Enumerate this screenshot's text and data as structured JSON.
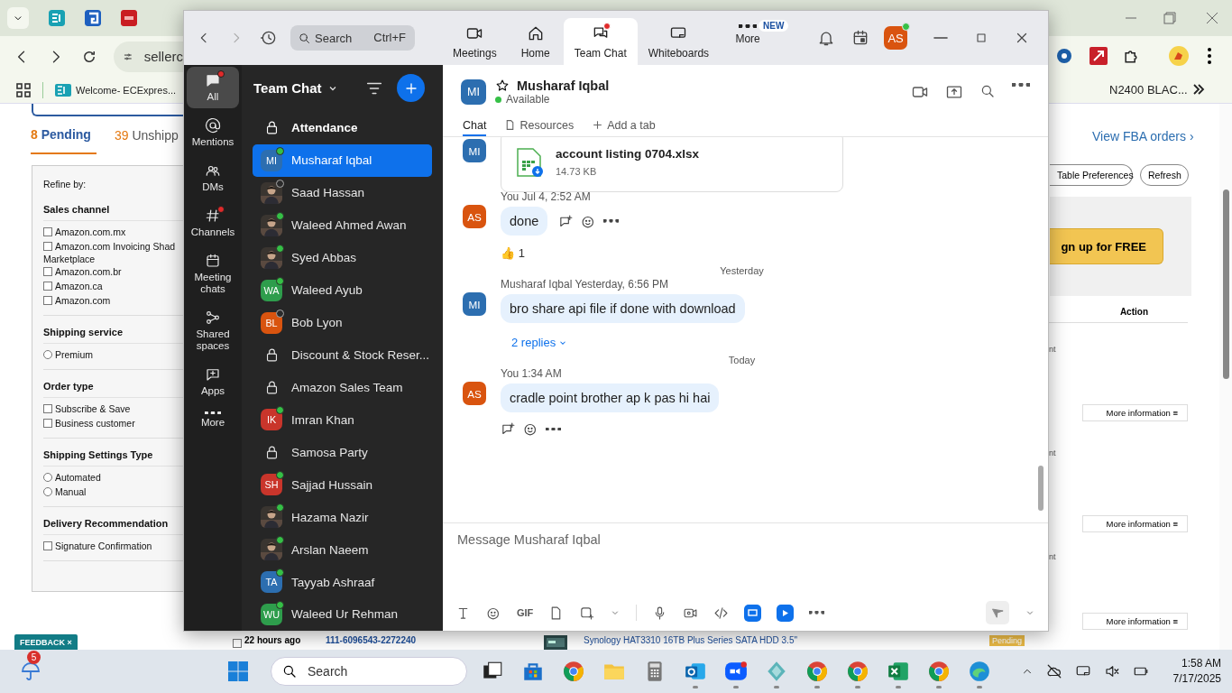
{
  "browser": {
    "address": "sellerc",
    "bookmarks": [
      "Welcome- ECExpres...",
      "N2400 BLAC..."
    ],
    "order_tabs": [
      {
        "count": "8",
        "label": "Pending",
        "selected": true
      },
      {
        "count": "39",
        "label": "Unshipp",
        "selected": false
      }
    ],
    "view_fba": "View FBA orders ›",
    "refine_label": "Refine by:",
    "filters": [
      {
        "title": "Sales channel",
        "options": [
          {
            "kind": "checkbox",
            "label": "Amazon.com.mx",
            "checked": false
          },
          {
            "kind": "checkbox",
            "label": "Amazon.com Invoicing Shad",
            "checked": false,
            "continuation": "Marketplace"
          },
          {
            "kind": "checkbox",
            "label": "Amazon.com.br",
            "checked": false
          },
          {
            "kind": "checkbox",
            "label": "Amazon.ca",
            "checked": false
          },
          {
            "kind": "checkbox",
            "label": "Amazon.com",
            "checked": false
          }
        ]
      },
      {
        "title": "Shipping service",
        "options": [
          {
            "kind": "radio",
            "label": "Premium",
            "checked": false
          }
        ]
      },
      {
        "title": "Order type",
        "options": [
          {
            "kind": "checkbox",
            "label": "Subscribe & Save",
            "checked": false
          },
          {
            "kind": "checkbox",
            "label": "Business customer",
            "checked": false
          }
        ]
      },
      {
        "title": "Shipping Settings Type",
        "options": [
          {
            "kind": "radio",
            "label": "Automated",
            "checked": false
          },
          {
            "kind": "radio",
            "label": "Manual",
            "checked": false
          }
        ]
      },
      {
        "title": "Delivery Recommendation",
        "options": [
          {
            "kind": "checkbox",
            "label": "Signature Confirmation",
            "checked": false
          }
        ]
      }
    ],
    "table_buttons": [
      "Table Preferences",
      "Refresh"
    ],
    "banner_button": "gn up for FREE",
    "action_header": "Action",
    "row_fragments": [
      "nt",
      "nt",
      "nt"
    ],
    "more_info": [
      "More information ≡",
      "More information ≡",
      "More information ≡"
    ],
    "order_row": {
      "checked": false,
      "age": "22 hours ago",
      "order_id": "111-6096543-2272240",
      "product": "Synology HAT3310 16TB Plus Series SATA HDD 3.5\"",
      "status": "Pending"
    },
    "feedback": "FEEDBACK ×"
  },
  "zoom": {
    "search": {
      "placeholder": "Search",
      "shortcut": "Ctrl+F"
    },
    "nav": [
      {
        "kind": "meetings",
        "label": "Meetings",
        "selected": false,
        "unread": false
      },
      {
        "kind": "home",
        "label": "Home",
        "selected": false,
        "unread": false
      },
      {
        "kind": "chat",
        "label": "Team Chat",
        "selected": true,
        "unread": true
      },
      {
        "kind": "whiteboards",
        "label": "Whiteboards",
        "selected": false,
        "unread": false
      },
      {
        "kind": "more",
        "label": "More",
        "selected": false,
        "unread": false,
        "badge": "NEW"
      }
    ],
    "user": {
      "initials": "AS",
      "color": "#d9540f",
      "online": true
    },
    "rail": [
      {
        "kind": "all",
        "label": "All",
        "selected": true,
        "unread": true
      },
      {
        "kind": "mentions",
        "label": "Mentions",
        "selected": false,
        "unread": false
      },
      {
        "kind": "dms",
        "label": "DMs",
        "selected": false,
        "unread": false
      },
      {
        "kind": "channels",
        "label": "Channels",
        "selected": false,
        "unread": true
      },
      {
        "kind": "meeting",
        "label": "Meeting chats",
        "selected": false,
        "unread": false
      },
      {
        "kind": "shared",
        "label": "Shared spaces",
        "selected": false,
        "unread": false
      },
      {
        "kind": "apps",
        "label": "Apps",
        "selected": false,
        "unread": false
      },
      {
        "kind": "more",
        "label": "More",
        "selected": false,
        "unread": false
      }
    ],
    "list_title": "Team Chat",
    "chats": [
      {
        "kind": "channel",
        "name": "Attendance",
        "selected": false,
        "bold": true
      },
      {
        "kind": "initials",
        "initials": "MI",
        "color": "#2c6eb0",
        "name": "Musharaf Iqbal",
        "selected": true,
        "online": true,
        "bold": false
      },
      {
        "name": "Saad Hassan",
        "selected": false,
        "online": false,
        "bold": false
      },
      {
        "name": "Waleed Ahmed Awan",
        "selected": false,
        "online": true,
        "bold": false
      },
      {
        "name": "Syed Abbas",
        "selected": false,
        "online": true,
        "bold": false
      },
      {
        "kind": "initials",
        "initials": "WA",
        "color": "#2e9d4c",
        "name": "Waleed Ayub",
        "selected": false,
        "online": true,
        "bold": false
      },
      {
        "kind": "initials",
        "initials": "BL",
        "color": "#d9540f",
        "name": "Bob Lyon",
        "selected": false,
        "online": false,
        "bold": false
      },
      {
        "kind": "channel",
        "name": "Discount & Stock Reser...",
        "selected": false,
        "bold": false
      },
      {
        "kind": "channel",
        "name": "Amazon Sales Team",
        "selected": false,
        "bold": false
      },
      {
        "kind": "initials",
        "initials": "IK",
        "color": "#c9352b",
        "name": "Imran Khan",
        "selected": false,
        "online": true,
        "bold": false
      },
      {
        "kind": "channel",
        "name": "Samosa Party",
        "selected": false,
        "bold": false
      },
      {
        "kind": "initials",
        "initials": "SH",
        "color": "#c9352b",
        "name": "Sajjad Hussain",
        "selected": false,
        "online": true,
        "bold": false
      },
      {
        "name": "Hazama Nazir",
        "selected": false,
        "online": true,
        "bold": false
      },
      {
        "name": "Arslan Naeem",
        "selected": false,
        "online": true,
        "bold": false
      },
      {
        "kind": "initials",
        "initials": "TA",
        "color": "#2c6eb0",
        "name": "Tayyab Ashraaf",
        "selected": false,
        "online": true,
        "bold": false
      },
      {
        "kind": "initials",
        "initials": "WU",
        "color": "#2e9d4c",
        "name": "Waleed Ur Rehman",
        "selected": false,
        "online": true,
        "bold": false
      }
    ],
    "contact": {
      "initials": "MI",
      "color": "#2c6eb0",
      "name": "Musharaf Iqbal",
      "status": "Available"
    },
    "chat_tabs": [
      {
        "kind": "chat",
        "label": "Chat",
        "selected": true
      },
      {
        "kind": "resources",
        "label": "Resources",
        "selected": false
      },
      {
        "kind": "add",
        "label": "Add a tab",
        "selected": false
      }
    ],
    "messages": [
      {
        "kind": "file",
        "initials": "MI",
        "color": "#2c6eb0",
        "file_name": "account listing 0704.xlsx",
        "file_size": "14.73 KB"
      },
      {
        "kind": "message",
        "initials": "AS",
        "color": "#d9540f",
        "author": "You",
        "time": "Jul 4, 2:52 AM",
        "text": "done",
        "actions_below": false,
        "reaction": {
          "emoji": "👍",
          "count": "1"
        }
      },
      {
        "kind": "divider",
        "label": "Yesterday"
      },
      {
        "kind": "message",
        "initials": "MI",
        "color": "#2c6eb0",
        "author": "Musharaf Iqbal",
        "time": "Yesterday, 6:56 PM",
        "text": "bro share api file if done with download",
        "replies": "2 replies"
      },
      {
        "kind": "divider",
        "label": "Today"
      },
      {
        "kind": "message",
        "initials": "AS",
        "color": "#d9540f",
        "author": "You",
        "time": "1:34 AM",
        "text": "cradle point brother ap k pas hi hai",
        "actions_below": true
      }
    ],
    "composer": {
      "placeholder": "Message Musharaf Iqbal",
      "gif": "GIF"
    }
  },
  "taskbar": {
    "weather_badge": "5",
    "search": {
      "placeholder": "Search"
    },
    "apps": [
      {
        "kind": "taskview",
        "running": false
      },
      {
        "kind": "store",
        "running": false
      },
      {
        "kind": "chrome",
        "running": false
      },
      {
        "kind": "files",
        "running": false
      },
      {
        "kind": "calculator",
        "running": false
      },
      {
        "kind": "outlook",
        "running": true
      },
      {
        "kind": "zoom",
        "running": true
      },
      {
        "kind": "gem",
        "running": true
      },
      {
        "kind": "chrome",
        "running": true
      },
      {
        "kind": "chrome",
        "running": true
      },
      {
        "kind": "excel",
        "running": true
      },
      {
        "kind": "chrome",
        "running": true
      },
      {
        "kind": "edge",
        "running": true
      }
    ],
    "time": "1:58 AM",
    "date": "7/17/2025"
  }
}
